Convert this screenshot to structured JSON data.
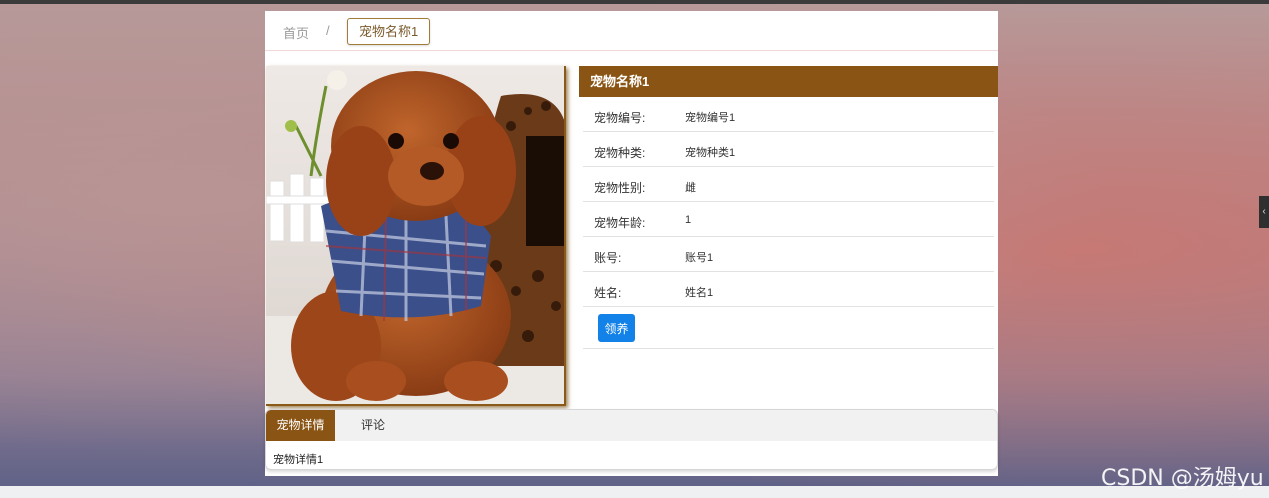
{
  "breadcrumb": {
    "home": "首页",
    "separator": "/",
    "current": "宠物名称1"
  },
  "pet": {
    "name": "宠物名称1",
    "fields": [
      {
        "label": "宠物编号:",
        "value": "宠物编号1"
      },
      {
        "label": "宠物种类:",
        "value": "宠物种类1"
      },
      {
        "label": "宠物性别:",
        "value": "雌"
      },
      {
        "label": "宠物年龄:",
        "value": "1"
      },
      {
        "label": "账号:",
        "value": "账号1"
      },
      {
        "label": "姓名:",
        "value": "姓名1"
      }
    ],
    "adopt_button": "领养"
  },
  "tabs": {
    "items": [
      {
        "label": "宠物详情",
        "active": true
      },
      {
        "label": "评论",
        "active": false
      }
    ],
    "content": "宠物详情1"
  },
  "watermark": "CSDN @汤姆yu",
  "colors": {
    "accent": "#8a5514",
    "button": "#1282e8"
  }
}
